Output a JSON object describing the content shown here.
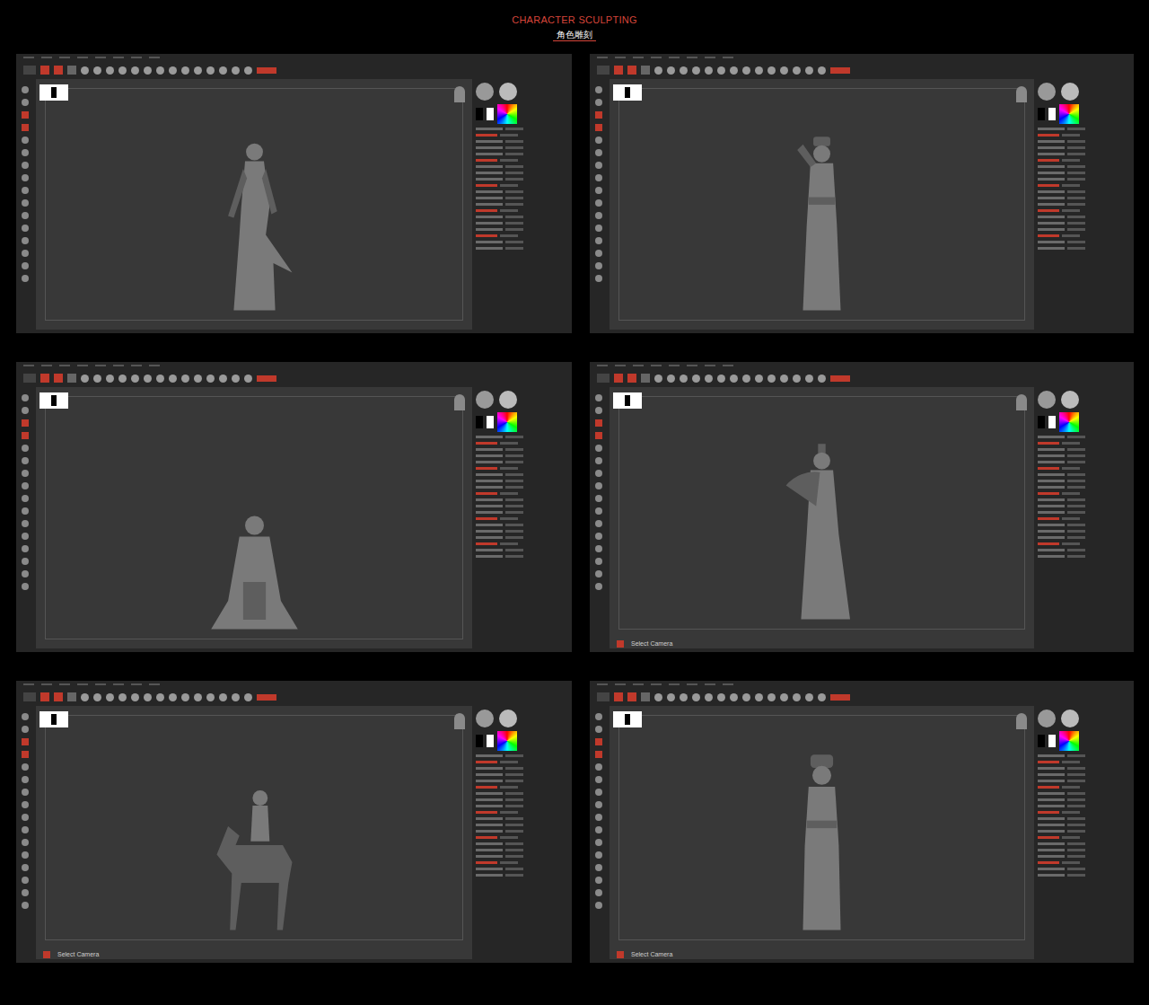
{
  "header": {
    "title": "CHARACTER SCULPTING",
    "subtitle": "角色雕刻"
  },
  "panels": [
    {
      "kind": "swordsman",
      "status": ""
    },
    {
      "kind": "waving",
      "status": ""
    },
    {
      "kind": "seated",
      "status": ""
    },
    {
      "kind": "fan",
      "status": "Select Camera"
    },
    {
      "kind": "rider",
      "status": "Select Camera"
    },
    {
      "kind": "scholar",
      "status": "Select Camera"
    }
  ]
}
